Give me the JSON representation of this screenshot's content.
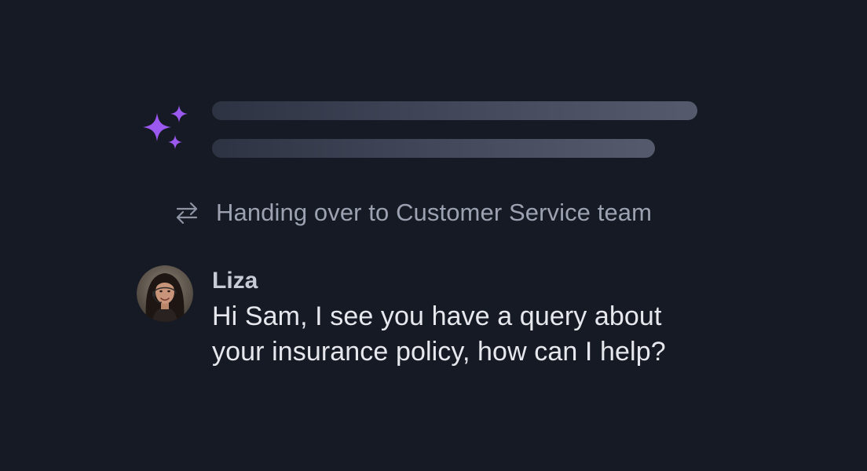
{
  "colors": {
    "background": "#161a24",
    "accent": "#9b59f0",
    "muted_text": "#9ca2b1",
    "primary_text": "#e6e8ee"
  },
  "ai_response": {
    "icon": "sparkles-icon",
    "state": "loading"
  },
  "handover": {
    "icon": "swap-arrows-icon",
    "text": "Handing over to Customer Service team"
  },
  "message": {
    "avatar": "agent-avatar",
    "sender": "Liza",
    "lines": [
      "Hi Sam, I see you have a query about",
      "your insurance policy, how can I help?"
    ]
  }
}
